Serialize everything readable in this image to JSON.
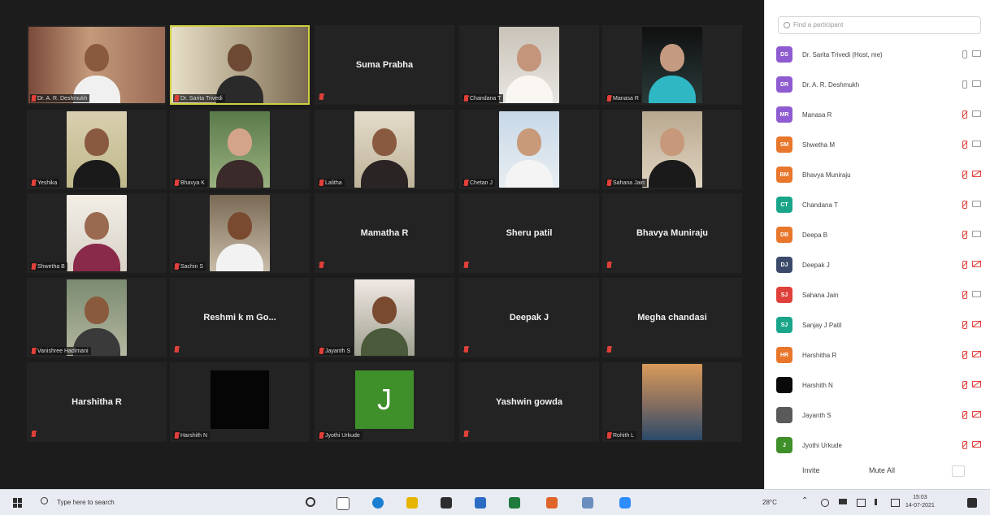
{
  "gallery": {
    "tiles": [
      {
        "name": "Dr. A. R. Deshmukh",
        "type": "video"
      },
      {
        "name": "Dr. Sarita Trivedi",
        "type": "video",
        "active": true
      },
      {
        "name": "Suma Prabha",
        "type": "name"
      },
      {
        "name": "Chandana T",
        "type": "video"
      },
      {
        "name": "Manasa R",
        "type": "video"
      },
      {
        "name": "Yeshika",
        "type": "video"
      },
      {
        "name": "Bhavya K",
        "type": "video"
      },
      {
        "name": "Lalitha",
        "type": "video"
      },
      {
        "name": "Chetan J",
        "type": "video"
      },
      {
        "name": "Sahana Jain",
        "type": "video"
      },
      {
        "name": "Shwetha B",
        "type": "video"
      },
      {
        "name": "Sachin S",
        "type": "video"
      },
      {
        "name": "Mamatha R",
        "type": "name"
      },
      {
        "name": "Sheru patil",
        "type": "name"
      },
      {
        "name": "Bhavya Muniraju",
        "type": "name"
      },
      {
        "name": "Vanishree Hadimani",
        "type": "video"
      },
      {
        "name": "Reshmi k m Go...",
        "type": "name"
      },
      {
        "name": "Jayanth S",
        "type": "video"
      },
      {
        "name": "Deepak J",
        "type": "name"
      },
      {
        "name": "Megha chandasi",
        "type": "name"
      },
      {
        "name": "Harshitha R",
        "type": "name"
      },
      {
        "name": "Harshith N",
        "type": "black"
      },
      {
        "name": "Jyothi Urkude",
        "type": "avatar",
        "initial": "J"
      },
      {
        "name": "Yashwin gowda",
        "type": "name"
      },
      {
        "name": "Rohith L",
        "type": "video"
      }
    ]
  },
  "participants": {
    "search_placeholder": "Find a participant",
    "list": [
      {
        "initials": "DS",
        "name": "Dr. Sarita Trivedi (Host, me)",
        "color": "#8e5bd0",
        "mic_muted": false,
        "cam_off": false
      },
      {
        "initials": "DR",
        "name": "Dr. A. R. Deshmukh",
        "color": "#8e5bd0",
        "mic_muted": false,
        "cam_off": false
      },
      {
        "initials": "MR",
        "name": "Manasa R",
        "color": "#8e5bd0",
        "mic_muted": true,
        "cam_off": false
      },
      {
        "initials": "SM",
        "name": "Shwetha M",
        "color": "#e8762b",
        "mic_muted": true,
        "cam_off": false
      },
      {
        "initials": "BM",
        "name": "Bhavya Muniraju",
        "color": "#e8762b",
        "mic_muted": true,
        "cam_off": true
      },
      {
        "initials": "CT",
        "name": "Chandana T",
        "color": "#1aa58a",
        "mic_muted": true,
        "cam_off": false
      },
      {
        "initials": "DB",
        "name": "Deepa B",
        "color": "#e8762b",
        "mic_muted": true,
        "cam_off": false
      },
      {
        "initials": "DJ",
        "name": "Deepak J",
        "color": "#3b4a6a",
        "mic_muted": true,
        "cam_off": true
      },
      {
        "initials": "SJ",
        "name": "Sahana Jain",
        "color": "#e0403a",
        "mic_muted": true,
        "cam_off": false
      },
      {
        "initials": "SJ",
        "name": "Sanjay J Patil",
        "color": "#1aa58a",
        "mic_muted": true,
        "cam_off": true
      },
      {
        "initials": "HR",
        "name": "Harshitha R",
        "color": "#e8762b",
        "mic_muted": true,
        "cam_off": true
      },
      {
        "initials": "",
        "name": "Harshith N",
        "color": "#0a0a0a",
        "mic_muted": true,
        "cam_off": true
      },
      {
        "initials": "",
        "name": "Jayanth S",
        "color": "#5a5a5a",
        "mic_muted": true,
        "cam_off": true
      },
      {
        "initials": "J",
        "name": "Jyothi Urkude",
        "color": "#3f8f2a",
        "mic_muted": true,
        "cam_off": true
      }
    ],
    "footer": {
      "invite": "Invite",
      "mute_all": "Mute All"
    }
  },
  "taskbar": {
    "search_text": "Type here to search",
    "temperature": "28°C",
    "time": "15:03",
    "date": "14-07-2021"
  }
}
